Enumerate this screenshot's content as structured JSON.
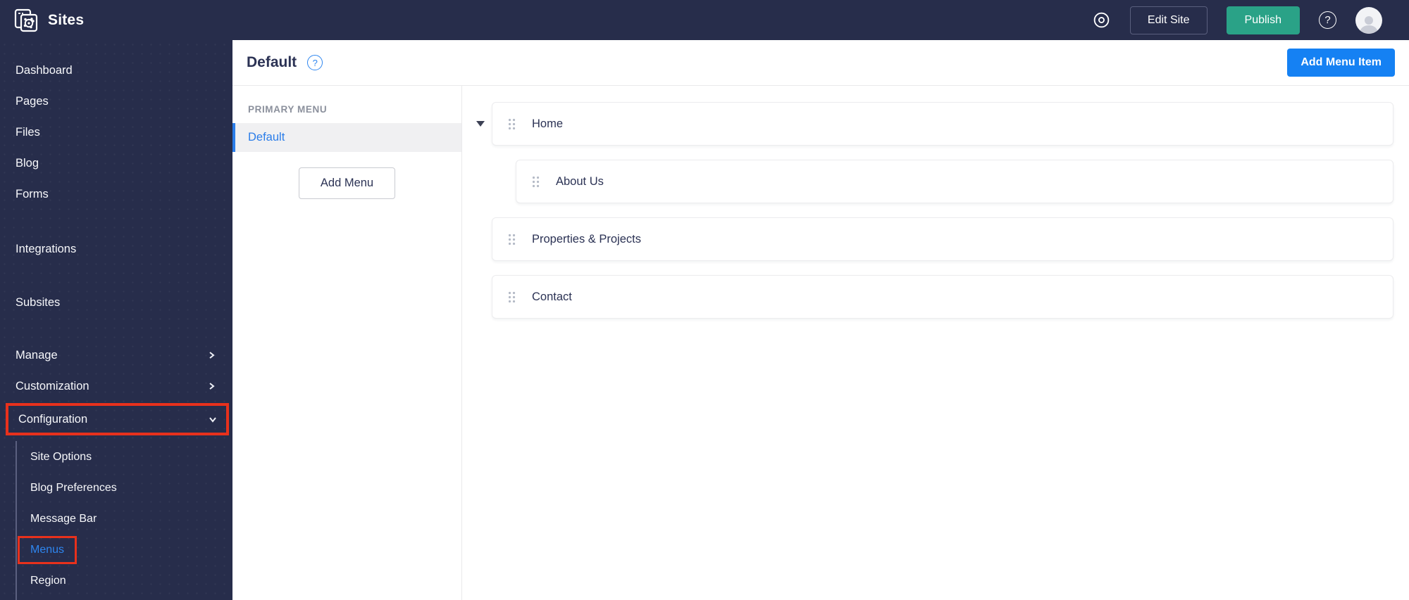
{
  "topbar": {
    "app_title": "Sites",
    "edit_site_label": "Edit Site",
    "publish_label": "Publish",
    "help_glyph": "?"
  },
  "sidebar": {
    "items": [
      "Dashboard",
      "Pages",
      "Files",
      "Blog",
      "Forms",
      "Integrations",
      "Subsites"
    ],
    "groups": [
      {
        "label": "Manage",
        "state": "collapsed"
      },
      {
        "label": "Customization",
        "state": "collapsed"
      },
      {
        "label": "Configuration",
        "state": "expanded",
        "annotated": true
      }
    ],
    "configuration_children": [
      "Site Options",
      "Blog Preferences",
      "Message Bar",
      "Menus",
      "Region"
    ],
    "active_item": "Menus"
  },
  "header": {
    "title": "Default",
    "help_glyph": "?",
    "add_menu_item_label": "Add Menu Item"
  },
  "menu_panel": {
    "section_label": "PRIMARY MENU",
    "selected_menu": "Default",
    "add_menu_label": "Add Menu"
  },
  "menu_items": [
    {
      "label": "Home",
      "level": 0,
      "has_children": true,
      "expanded": true
    },
    {
      "label": "About Us",
      "level": 1
    },
    {
      "label": "Properties & Projects",
      "level": 0
    },
    {
      "label": "Contact",
      "level": 0
    }
  ],
  "colors": {
    "topbar_bg": "#272d4b",
    "publish_green": "#2aa287",
    "primary_blue": "#1581f3",
    "link_blue": "#2e86f0",
    "selected_menu_blue": "#2b7de9",
    "annotation_red": "#e8311c"
  }
}
